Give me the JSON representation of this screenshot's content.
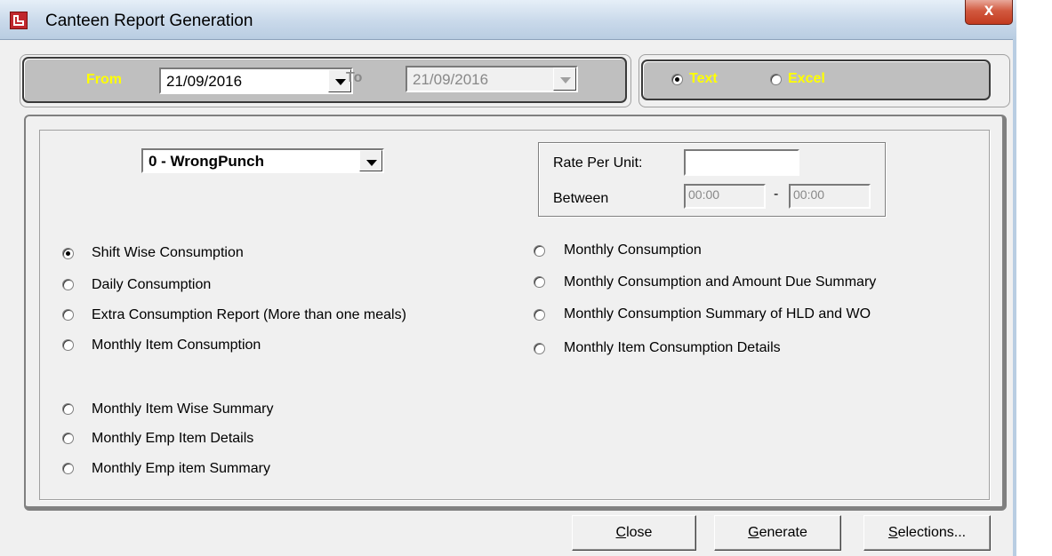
{
  "window": {
    "title": "Canteen Report Generation",
    "close_glyph": "x"
  },
  "date_range": {
    "from_label": "From",
    "from_value": "21/09/2016",
    "to_label": "To",
    "to_value": "21/09/2016"
  },
  "output_format": {
    "options": [
      {
        "label": "Text",
        "checked": true
      },
      {
        "label": "Excel",
        "checked": false
      }
    ]
  },
  "punch_select": {
    "value": "0  - WrongPunch"
  },
  "rate_box": {
    "rate_label": "Rate Per Unit:",
    "rate_value": "",
    "between_label": "Between",
    "time_from": "00:00",
    "dash": "-",
    "time_to": "00:00"
  },
  "reports_left": [
    {
      "label": "Shift Wise Consumption",
      "checked": true
    },
    {
      "label": "Daily Consumption",
      "checked": false
    },
    {
      "label": "Extra Consumption Report (More than one meals)",
      "checked": false
    },
    {
      "label": "Monthly Item Consumption",
      "checked": false
    },
    {
      "label": "Monthly Item Wise Summary",
      "checked": false
    },
    {
      "label": "Monthly Emp Item Details",
      "checked": false
    },
    {
      "label": "Monthly Emp item Summary",
      "checked": false
    }
  ],
  "reports_right": [
    {
      "label": "Monthly Consumption",
      "checked": false
    },
    {
      "label": "Monthly Consumption and Amount Due Summary",
      "checked": false
    },
    {
      "label": "Monthly Consumption Summary of HLD and WO",
      "checked": false
    },
    {
      "label": "Monthly Item Consumption Details",
      "checked": false
    }
  ],
  "buttons": {
    "close": {
      "mnemonic": "C",
      "rest": "lose"
    },
    "generate": {
      "mnemonic": "G",
      "rest": "enerate"
    },
    "selections": {
      "mnemonic": "S",
      "rest": "elections..."
    }
  },
  "colors": {
    "highlight_label": "#ffff00",
    "groupbox": "#bfbfbf",
    "titlebar": "#c9d9ea",
    "close_button": "#c23a1f"
  }
}
